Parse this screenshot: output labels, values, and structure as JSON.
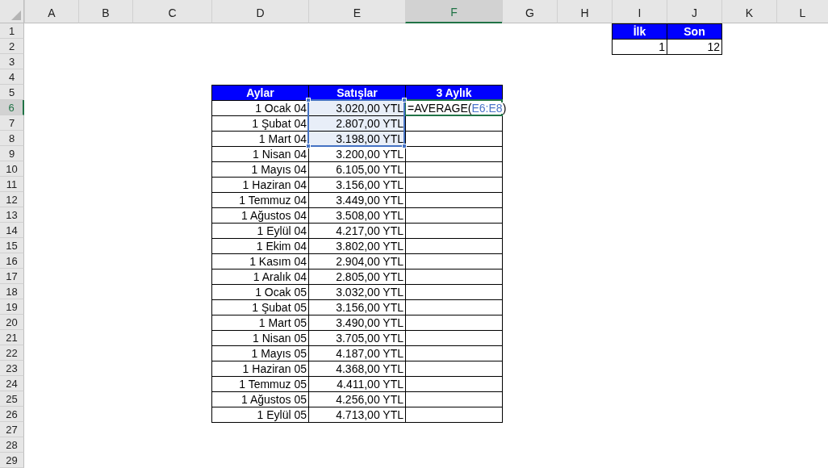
{
  "sheet": {
    "columns": [
      {
        "label": "A",
        "selected": false
      },
      {
        "label": "B",
        "selected": false
      },
      {
        "label": "C",
        "selected": false
      },
      {
        "label": "D",
        "selected": false
      },
      {
        "label": "E",
        "selected": false
      },
      {
        "label": "F",
        "selected": true
      },
      {
        "label": "G",
        "selected": false
      },
      {
        "label": "H",
        "selected": false
      },
      {
        "label": "I",
        "selected": false
      },
      {
        "label": "J",
        "selected": false
      },
      {
        "label": "K",
        "selected": false
      },
      {
        "label": "L",
        "selected": false
      }
    ],
    "rows": [
      {
        "label": "1",
        "selected": false
      },
      {
        "label": "2",
        "selected": false
      },
      {
        "label": "3",
        "selected": false
      },
      {
        "label": "4",
        "selected": false
      },
      {
        "label": "5",
        "selected": false
      },
      {
        "label": "6",
        "selected": true
      },
      {
        "label": "7",
        "selected": false
      },
      {
        "label": "8",
        "selected": false
      },
      {
        "label": "9",
        "selected": false
      },
      {
        "label": "10",
        "selected": false
      },
      {
        "label": "11",
        "selected": false
      },
      {
        "label": "12",
        "selected": false
      },
      {
        "label": "13",
        "selected": false
      },
      {
        "label": "14",
        "selected": false
      },
      {
        "label": "15",
        "selected": false
      },
      {
        "label": "16",
        "selected": false
      },
      {
        "label": "17",
        "selected": false
      },
      {
        "label": "18",
        "selected": false
      },
      {
        "label": "19",
        "selected": false
      },
      {
        "label": "20",
        "selected": false
      },
      {
        "label": "21",
        "selected": false
      },
      {
        "label": "22",
        "selected": false
      },
      {
        "label": "23",
        "selected": false
      },
      {
        "label": "24",
        "selected": false
      },
      {
        "label": "25",
        "selected": false
      },
      {
        "label": "26",
        "selected": false
      },
      {
        "label": "27",
        "selected": false
      },
      {
        "label": "28",
        "selected": false
      },
      {
        "label": "29",
        "selected": false
      }
    ],
    "tables": [
      {
        "headers": [
          "İlk",
          "Son"
        ],
        "rows": [
          [
            "1",
            "12"
          ]
        ]
      },
      {
        "headers": [
          "Aylar",
          "Satışlar",
          "3 Aylık"
        ],
        "rows": [
          [
            "1 Ocak 04",
            {
              "kind": "value",
              "text": "3.020,00 YTL",
              "referenced": true
            },
            {
              "kind": "formula",
              "active": true,
              "parts": [
                {
                  "kind": "plain",
                  "text": "=AVERAGE("
                },
                {
                  "kind": "reference",
                  "text": "E6:E8"
                },
                {
                  "kind": "plain",
                  "text": ")"
                }
              ]
            }
          ],
          [
            "1 Şubat 04",
            {
              "kind": "value",
              "text": "2.807,00 YTL",
              "referenced": true
            },
            null
          ],
          [
            "1 Mart 04",
            {
              "kind": "value",
              "text": "3.198,00 YTL",
              "referenced": true
            },
            null
          ],
          [
            "1 Nisan 04",
            "3.200,00 YTL",
            null
          ],
          [
            "1 Mayıs 04",
            "6.105,00 YTL",
            null
          ],
          [
            "1 Haziran 04",
            "3.156,00 YTL",
            null
          ],
          [
            "1 Temmuz 04",
            "3.449,00 YTL",
            null
          ],
          [
            "1 Ağustos 04",
            "3.508,00 YTL",
            null
          ],
          [
            "1 Eylül 04",
            "4.217,00 YTL",
            null
          ],
          [
            "1 Ekim 04",
            "3.802,00 YTL",
            null
          ],
          [
            "1 Kasım 04",
            "2.904,00 YTL",
            null
          ],
          [
            "1 Aralık 04",
            "2.805,00 YTL",
            null
          ],
          [
            "1 Ocak 05",
            "3.032,00 YTL",
            null
          ],
          [
            "1 Şubat 05",
            "3.156,00 YTL",
            null
          ],
          [
            "1 Mart 05",
            "3.490,00 YTL",
            null
          ],
          [
            "1 Nisan 05",
            "3.705,00 YTL",
            null
          ],
          [
            "1 Mayıs 05",
            "4.187,00 YTL",
            null
          ],
          [
            "1 Haziran 05",
            "4.368,00 YTL",
            null
          ],
          [
            "1 Temmuz 05",
            "4.411,00 YTL",
            null
          ],
          [
            "1 Ağustos 05",
            "4.256,00 YTL",
            null
          ],
          [
            "1 Eylül 05",
            "4.713,00 YTL",
            null
          ]
        ]
      }
    ]
  }
}
